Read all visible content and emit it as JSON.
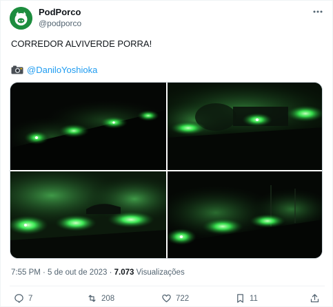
{
  "tweet": {
    "author_name": "PodPorco",
    "author_handle": "@podporco",
    "text": "CORREDOR ALVIVERDE PORRA!",
    "credit_prefix_icon": "camera-icon",
    "credit_link": "@DaniloYoshioka",
    "timestamp": "7:55 PM · 5 de out de 2023 · ",
    "views_count": "7.073",
    "views_label": " Visualizações"
  },
  "media": {
    "photos": [
      {
        "name": "photo-1"
      },
      {
        "name": "photo-2"
      },
      {
        "name": "photo-3"
      },
      {
        "name": "photo-4"
      }
    ]
  },
  "actions": {
    "replies": "7",
    "retweets": "208",
    "likes": "722",
    "bookmarks": "11"
  },
  "colors": {
    "accent": "#1d9bf0",
    "muted": "#536471",
    "avatar_bg": "#1d8d3e",
    "flare_green": "#39ff5a"
  }
}
